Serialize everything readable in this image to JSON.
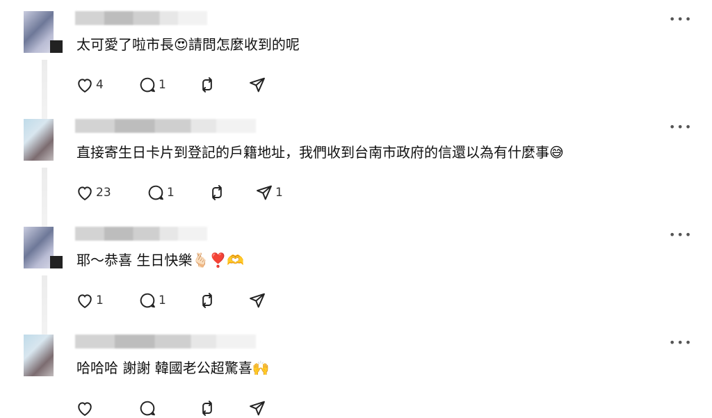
{
  "comments": [
    {
      "text": "太可愛了啦市長😍請問怎麼收到的呢",
      "counts": {
        "like": "4",
        "reply": "1",
        "repost": "",
        "share": ""
      }
    },
    {
      "text": "直接寄生日卡片到登記的戶籍地址，我們收到台南市政府的信還以為有什麼事😅",
      "counts": {
        "like": "23",
        "reply": "1",
        "repost": "",
        "share": "1"
      }
    },
    {
      "text": "耶～恭喜 生日快樂🫰🏻❣️🫶",
      "counts": {
        "like": "1",
        "reply": "1",
        "repost": "",
        "share": ""
      }
    },
    {
      "text": "哈哈哈 謝謝 韓國老公超驚喜🙌",
      "counts": {
        "like": "",
        "reply": "",
        "repost": "",
        "share": ""
      }
    }
  ],
  "more_label": "•••",
  "icons": {
    "like": "heart-icon",
    "reply": "reply-bubble-icon",
    "repost": "repost-icon",
    "share": "send-icon"
  }
}
